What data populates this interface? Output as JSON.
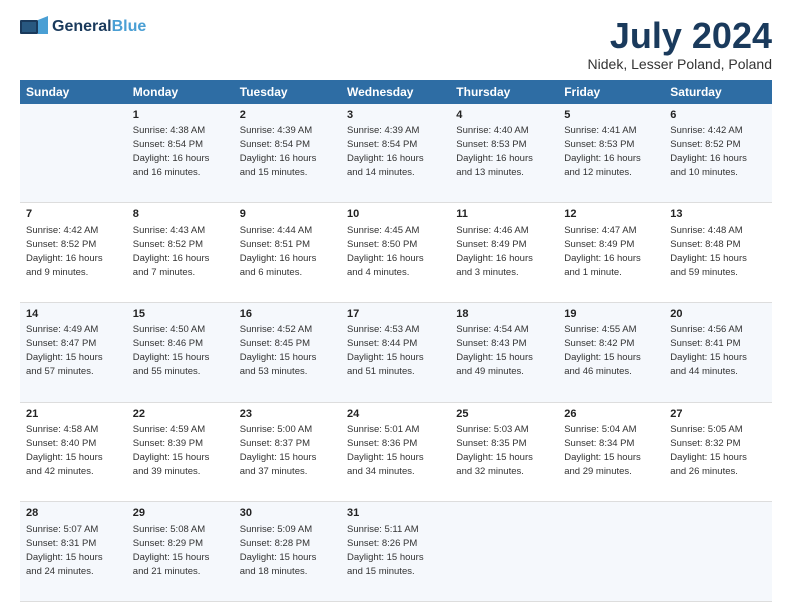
{
  "header": {
    "logo_general": "General",
    "logo_blue": "Blue",
    "title": "July 2024",
    "location": "Nidek, Lesser Poland, Poland"
  },
  "columns": [
    "Sunday",
    "Monday",
    "Tuesday",
    "Wednesday",
    "Thursday",
    "Friday",
    "Saturday"
  ],
  "weeks": [
    {
      "days": [
        {
          "num": "",
          "info": ""
        },
        {
          "num": "1",
          "info": "Sunrise: 4:38 AM\nSunset: 8:54 PM\nDaylight: 16 hours\nand 16 minutes."
        },
        {
          "num": "2",
          "info": "Sunrise: 4:39 AM\nSunset: 8:54 PM\nDaylight: 16 hours\nand 15 minutes."
        },
        {
          "num": "3",
          "info": "Sunrise: 4:39 AM\nSunset: 8:54 PM\nDaylight: 16 hours\nand 14 minutes."
        },
        {
          "num": "4",
          "info": "Sunrise: 4:40 AM\nSunset: 8:53 PM\nDaylight: 16 hours\nand 13 minutes."
        },
        {
          "num": "5",
          "info": "Sunrise: 4:41 AM\nSunset: 8:53 PM\nDaylight: 16 hours\nand 12 minutes."
        },
        {
          "num": "6",
          "info": "Sunrise: 4:42 AM\nSunset: 8:52 PM\nDaylight: 16 hours\nand 10 minutes."
        }
      ]
    },
    {
      "days": [
        {
          "num": "7",
          "info": "Sunrise: 4:42 AM\nSunset: 8:52 PM\nDaylight: 16 hours\nand 9 minutes."
        },
        {
          "num": "8",
          "info": "Sunrise: 4:43 AM\nSunset: 8:52 PM\nDaylight: 16 hours\nand 7 minutes."
        },
        {
          "num": "9",
          "info": "Sunrise: 4:44 AM\nSunset: 8:51 PM\nDaylight: 16 hours\nand 6 minutes."
        },
        {
          "num": "10",
          "info": "Sunrise: 4:45 AM\nSunset: 8:50 PM\nDaylight: 16 hours\nand 4 minutes."
        },
        {
          "num": "11",
          "info": "Sunrise: 4:46 AM\nSunset: 8:49 PM\nDaylight: 16 hours\nand 3 minutes."
        },
        {
          "num": "12",
          "info": "Sunrise: 4:47 AM\nSunset: 8:49 PM\nDaylight: 16 hours\nand 1 minute."
        },
        {
          "num": "13",
          "info": "Sunrise: 4:48 AM\nSunset: 8:48 PM\nDaylight: 15 hours\nand 59 minutes."
        }
      ]
    },
    {
      "days": [
        {
          "num": "14",
          "info": "Sunrise: 4:49 AM\nSunset: 8:47 PM\nDaylight: 15 hours\nand 57 minutes."
        },
        {
          "num": "15",
          "info": "Sunrise: 4:50 AM\nSunset: 8:46 PM\nDaylight: 15 hours\nand 55 minutes."
        },
        {
          "num": "16",
          "info": "Sunrise: 4:52 AM\nSunset: 8:45 PM\nDaylight: 15 hours\nand 53 minutes."
        },
        {
          "num": "17",
          "info": "Sunrise: 4:53 AM\nSunset: 8:44 PM\nDaylight: 15 hours\nand 51 minutes."
        },
        {
          "num": "18",
          "info": "Sunrise: 4:54 AM\nSunset: 8:43 PM\nDaylight: 15 hours\nand 49 minutes."
        },
        {
          "num": "19",
          "info": "Sunrise: 4:55 AM\nSunset: 8:42 PM\nDaylight: 15 hours\nand 46 minutes."
        },
        {
          "num": "20",
          "info": "Sunrise: 4:56 AM\nSunset: 8:41 PM\nDaylight: 15 hours\nand 44 minutes."
        }
      ]
    },
    {
      "days": [
        {
          "num": "21",
          "info": "Sunrise: 4:58 AM\nSunset: 8:40 PM\nDaylight: 15 hours\nand 42 minutes."
        },
        {
          "num": "22",
          "info": "Sunrise: 4:59 AM\nSunset: 8:39 PM\nDaylight: 15 hours\nand 39 minutes."
        },
        {
          "num": "23",
          "info": "Sunrise: 5:00 AM\nSunset: 8:37 PM\nDaylight: 15 hours\nand 37 minutes."
        },
        {
          "num": "24",
          "info": "Sunrise: 5:01 AM\nSunset: 8:36 PM\nDaylight: 15 hours\nand 34 minutes."
        },
        {
          "num": "25",
          "info": "Sunrise: 5:03 AM\nSunset: 8:35 PM\nDaylight: 15 hours\nand 32 minutes."
        },
        {
          "num": "26",
          "info": "Sunrise: 5:04 AM\nSunset: 8:34 PM\nDaylight: 15 hours\nand 29 minutes."
        },
        {
          "num": "27",
          "info": "Sunrise: 5:05 AM\nSunset: 8:32 PM\nDaylight: 15 hours\nand 26 minutes."
        }
      ]
    },
    {
      "days": [
        {
          "num": "28",
          "info": "Sunrise: 5:07 AM\nSunset: 8:31 PM\nDaylight: 15 hours\nand 24 minutes."
        },
        {
          "num": "29",
          "info": "Sunrise: 5:08 AM\nSunset: 8:29 PM\nDaylight: 15 hours\nand 21 minutes."
        },
        {
          "num": "30",
          "info": "Sunrise: 5:09 AM\nSunset: 8:28 PM\nDaylight: 15 hours\nand 18 minutes."
        },
        {
          "num": "31",
          "info": "Sunrise: 5:11 AM\nSunset: 8:26 PM\nDaylight: 15 hours\nand 15 minutes."
        },
        {
          "num": "",
          "info": ""
        },
        {
          "num": "",
          "info": ""
        },
        {
          "num": "",
          "info": ""
        }
      ]
    }
  ]
}
